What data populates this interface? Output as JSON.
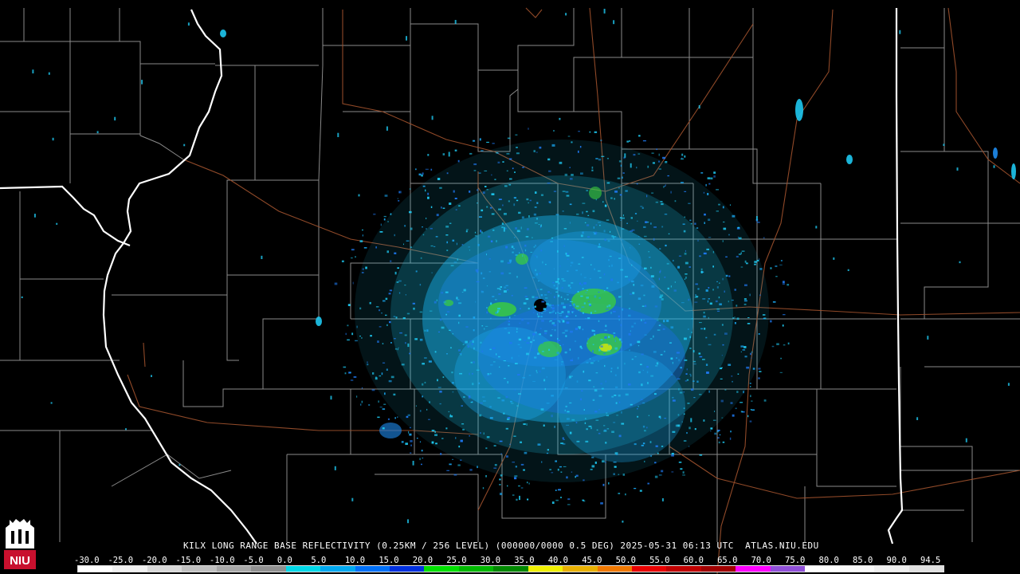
{
  "caption": "KILX LONG RANGE BASE REFLECTIVITY (0.25KM / 256 LEVEL) (000000/0000 0.5 DEG) 2025-05-31 06:13 UTC  ATLAS.NIU.EDU",
  "logo_text": "NIU",
  "scale": {
    "labels": [
      "-30.0",
      "-25.0",
      "-20.0",
      "-15.0",
      "-10.0",
      "-5.0",
      "0.0",
      "5.0",
      "10.0",
      "15.0",
      "20.0",
      "25.0",
      "30.0",
      "35.0",
      "40.0",
      "45.0",
      "50.0",
      "55.0",
      "60.0",
      "65.0",
      "70.0",
      "75.0",
      "80.0",
      "85.0",
      "90.0",
      "94.5"
    ],
    "colors": [
      "#ffffff",
      "#f0f0f0",
      "#d8d8d8",
      "#c0c0c0",
      "#a8a8a8",
      "#909090",
      "#00d8e8",
      "#00a8f0",
      "#0070f8",
      "#0030e0",
      "#00e000",
      "#00b800",
      "#008800",
      "#f0f000",
      "#e8b000",
      "#f07800",
      "#e80000",
      "#c00000",
      "#a00000",
      "#ff00ff",
      "#9050d8",
      "#ffffff",
      "#f8f8f8",
      "#eeeeee",
      "#e0e0e0"
    ]
  },
  "colors": {
    "background": "#000000",
    "county_lines": "#8a8a8a",
    "state_lines": "#ffffff",
    "highways": "#a0522d",
    "echo_light": "#1ec8f0",
    "echo_medium": "#1e78f0",
    "echo_strong": "#3cd03c"
  },
  "radar": {
    "site": "KILX"
  }
}
